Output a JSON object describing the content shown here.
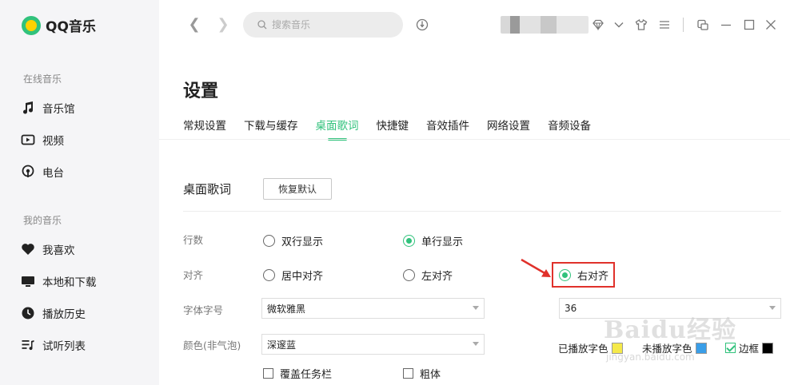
{
  "app": {
    "name": "QQ音乐"
  },
  "sidebar": {
    "online_title": "在线音乐",
    "online_items": [
      {
        "label": "音乐馆",
        "icon": "music-note-icon"
      },
      {
        "label": "视频",
        "icon": "video-icon"
      },
      {
        "label": "电台",
        "icon": "radio-icon"
      }
    ],
    "mine_title": "我的音乐",
    "mine_items": [
      {
        "label": "我喜欢",
        "icon": "heart-icon"
      },
      {
        "label": "本地和下载",
        "icon": "monitor-icon"
      },
      {
        "label": "播放历史",
        "icon": "clock-icon"
      },
      {
        "label": "试听列表",
        "icon": "playlist-icon"
      }
    ]
  },
  "topbar": {
    "search_placeholder": "搜索音乐",
    "icons": [
      "back-arrow-icon",
      "forward-arrow-icon",
      "search-icon",
      "recognize-icon",
      "vip-diamond-icon",
      "chevron-down-icon",
      "skin-shirt-icon",
      "menu-icon",
      "mini-mode-icon",
      "minimize-icon",
      "maximize-icon",
      "close-icon"
    ]
  },
  "settings": {
    "title": "设置",
    "tabs": [
      "常规设置",
      "下载与缓存",
      "桌面歌词",
      "快捷键",
      "音效插件",
      "网络设置",
      "音频设备"
    ],
    "active_tab": "桌面歌词",
    "section_title": "桌面歌词",
    "restore_button": "恢复默认",
    "lines": {
      "label": "行数",
      "options": [
        {
          "label": "双行显示",
          "checked": false
        },
        {
          "label": "单行显示",
          "checked": true
        }
      ]
    },
    "align": {
      "label": "对齐",
      "options": [
        {
          "label": "居中对齐",
          "checked": false
        },
        {
          "label": "左对齐",
          "checked": false
        },
        {
          "label": "右对齐",
          "checked": true
        }
      ]
    },
    "font": {
      "label": "字体字号",
      "family": "微软雅黑",
      "size": "36"
    },
    "color": {
      "label": "颜色(非气泡)",
      "scheme": "深邃蓝",
      "played_label": "已播放字色",
      "played_color": "#f5e94a",
      "unplayed_label": "未播放字色",
      "unplayed_color": "#3a9ee8",
      "border_label": "边框",
      "border_color": "#000000",
      "border_checked": true
    },
    "checkboxes": [
      {
        "label": "覆盖任务栏",
        "checked": false
      },
      {
        "label": "粗体",
        "checked": false
      }
    ]
  },
  "watermark": {
    "text": "Baidu经验",
    "sub": "jingyan.baidu.com"
  },
  "colors": {
    "accent": "#31c27c",
    "highlight_red": "#e0312b"
  }
}
